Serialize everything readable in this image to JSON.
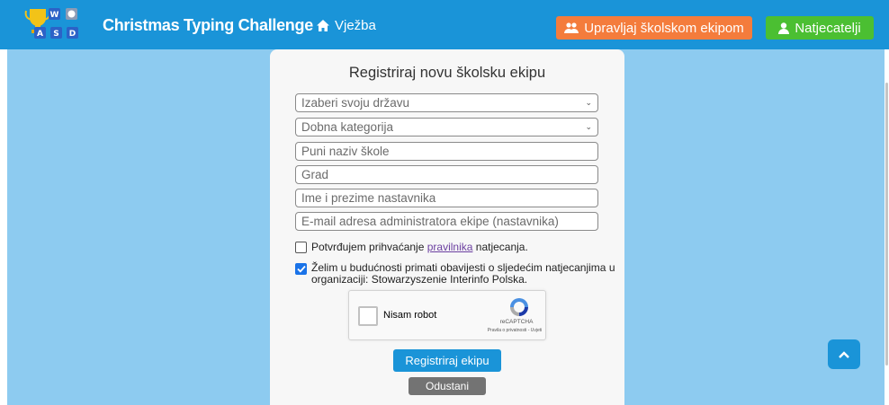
{
  "header": {
    "logo_letters": [
      "W",
      "A",
      "S",
      "D"
    ],
    "brand": "Christmas Typing Challenge",
    "nav_practice": "Vježba",
    "manage_button": "Upravljaj školskom ekipom",
    "competitors_button": "Natjecatelji"
  },
  "form": {
    "title": "Registriraj novu školsku ekipu",
    "country_select": "Izaberi svoju državu",
    "age_category_select": "Dobna kategorija",
    "school_name_placeholder": "Puni naziv škole",
    "city_placeholder": "Grad",
    "teacher_name_placeholder": "Ime i prezime nastavnika",
    "admin_email_placeholder": "E-mail adresa administratora ekipe (nastavnika)",
    "rules_checkbox": {
      "checked": false,
      "text_before": "Potvrđujem prihvaćanje ",
      "link": "pravilnika",
      "text_after": " natjecanja."
    },
    "newsletter_checkbox": {
      "checked": true,
      "text": "Želim u budućnosti primati obavijesti o sljedećim natjecanjima u organizaciji: Stowarzyszenie Interinfo Polska."
    },
    "captcha": {
      "label": "Nisam robot",
      "brand": "reCAPTCHA",
      "terms": "Pravila o privatnosti - Uvjeti"
    },
    "register_button": "Registriraj ekipu",
    "cancel_button": "Odustani"
  },
  "colors": {
    "header_bg": "#1a94d8",
    "page_bg": "#8dcbf0",
    "manage_button": "#f47c3c",
    "competitors_button": "#4bbf32",
    "register_button": "#1a94d8",
    "cancel_button": "#737373"
  },
  "icons": {
    "logo": "wasd-trophy-logo",
    "nav_practice": "home-icon",
    "manage_button": "users-icon",
    "competitors_button": "user-icon",
    "scroll_top": "chevron-up-icon"
  }
}
